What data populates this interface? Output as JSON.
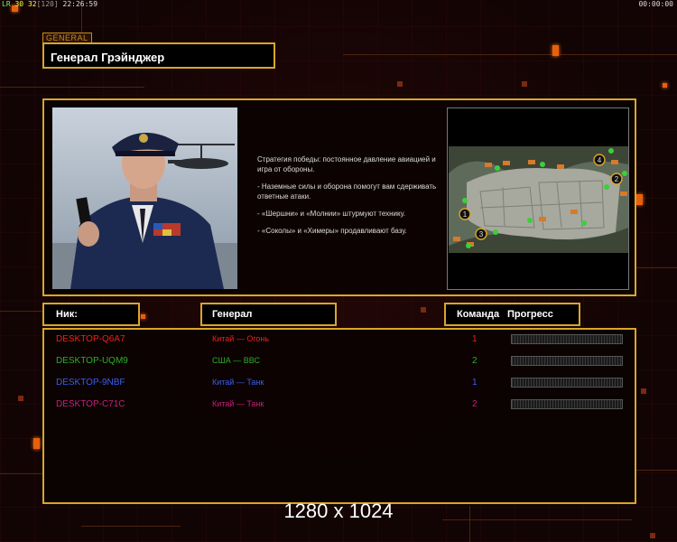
{
  "hud": {
    "lr": "LR",
    "n1": "30",
    "n2": "32",
    "n3": "[120]",
    "clock": "22:26:59",
    "timer": "00:00:00"
  },
  "general_tab": "GENERAL",
  "general_name": "Генерал Грэйнджер",
  "description": {
    "strategy": "Стратегия победы: постоянное давление авиацией и игра от обороны.",
    "tip1": "- Наземные силы и оборона помогут вам сдерживать ответные атаки.",
    "tip2": "- «Шершни» и «Молнии» штурмуют технику.",
    "tip3": "- «Соколы» и «Химеры» продавливают базу."
  },
  "map": {
    "markers": [
      "1",
      "2",
      "3",
      "4"
    ]
  },
  "columns": {
    "nick": "Ник:",
    "general": "Генерал",
    "team": "Команда",
    "progress": "Прогресс"
  },
  "players": [
    {
      "nick": "DESKTOP-Q6A7",
      "general": "Китай — Огонь",
      "team": "1",
      "color": "#e8241c",
      "progress": 0
    },
    {
      "nick": "DESKTOP-UQM9",
      "general": "США — ВВС",
      "team": "2",
      "color": "#2fae2a",
      "progress": 0
    },
    {
      "nick": "DESKTOP-9NBF",
      "general": "Китай — Танк",
      "team": "1",
      "color": "#3a5ff0",
      "progress": 0
    },
    {
      "nick": "DESKTOP-C71C",
      "general": "Китай — Танк",
      "team": "2",
      "color": "#c8207a",
      "progress": 0
    }
  ],
  "resolution": "1280 x 1024",
  "colors": {
    "frame": "#d9a62a",
    "accent": "#e8600c",
    "background": "#120404"
  }
}
